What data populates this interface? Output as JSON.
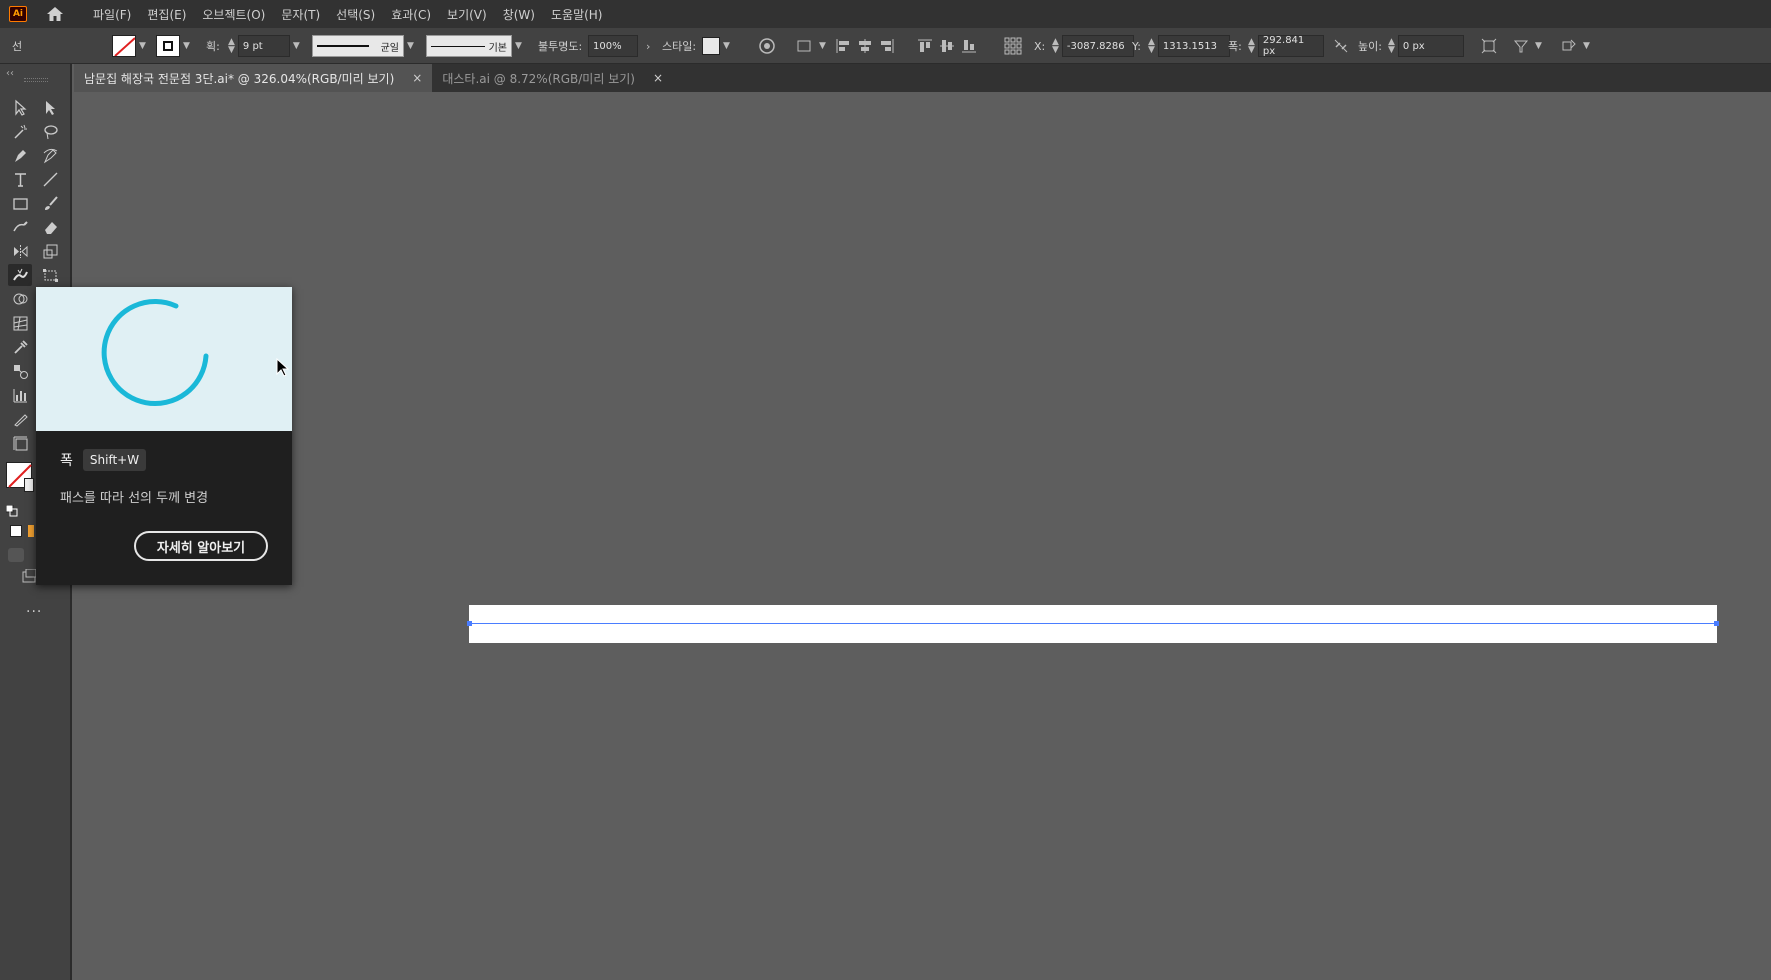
{
  "app": {
    "logo_text": "Ai"
  },
  "menu": [
    "파일(F)",
    "편집(E)",
    "오브젝트(O)",
    "문자(T)",
    "선택(S)",
    "효과(C)",
    "보기(V)",
    "창(W)",
    "도움말(H)"
  ],
  "control_bar": {
    "object_type": "선",
    "stroke_label": "획:",
    "stroke_weight": "9 pt",
    "profile": "균일",
    "brush": "기본",
    "opacity_label": "불투명도:",
    "opacity": "100%",
    "style_label": "스타일:",
    "x_label": "X:",
    "x_value": "-3087.8286",
    "y_label": "Y:",
    "y_value": "1313.1513",
    "width_label": "폭:",
    "width_value": "292.841 px",
    "height_label": "높이:",
    "height_value": "0 px"
  },
  "tabs": [
    {
      "label": "남문집 해장국 전문점 3단.ai* @ 326.04%(RGB/미리 보기)",
      "active": true
    },
    {
      "label": "대스타.ai @ 8.72%(RGB/미리 보기)",
      "active": false
    }
  ],
  "tooltip": {
    "title": "폭",
    "shortcut": "Shift+W",
    "description": "패스를 따라 선의 두께 변경",
    "button": "자세히 알아보기"
  },
  "colors": {
    "accent": "#4a7dff",
    "spinner": "#1ab8d8",
    "tooltip_bg": "#1f1f1f",
    "preview_bg": "#e0f0f4"
  },
  "toolbar": {
    "more_label": "..."
  }
}
